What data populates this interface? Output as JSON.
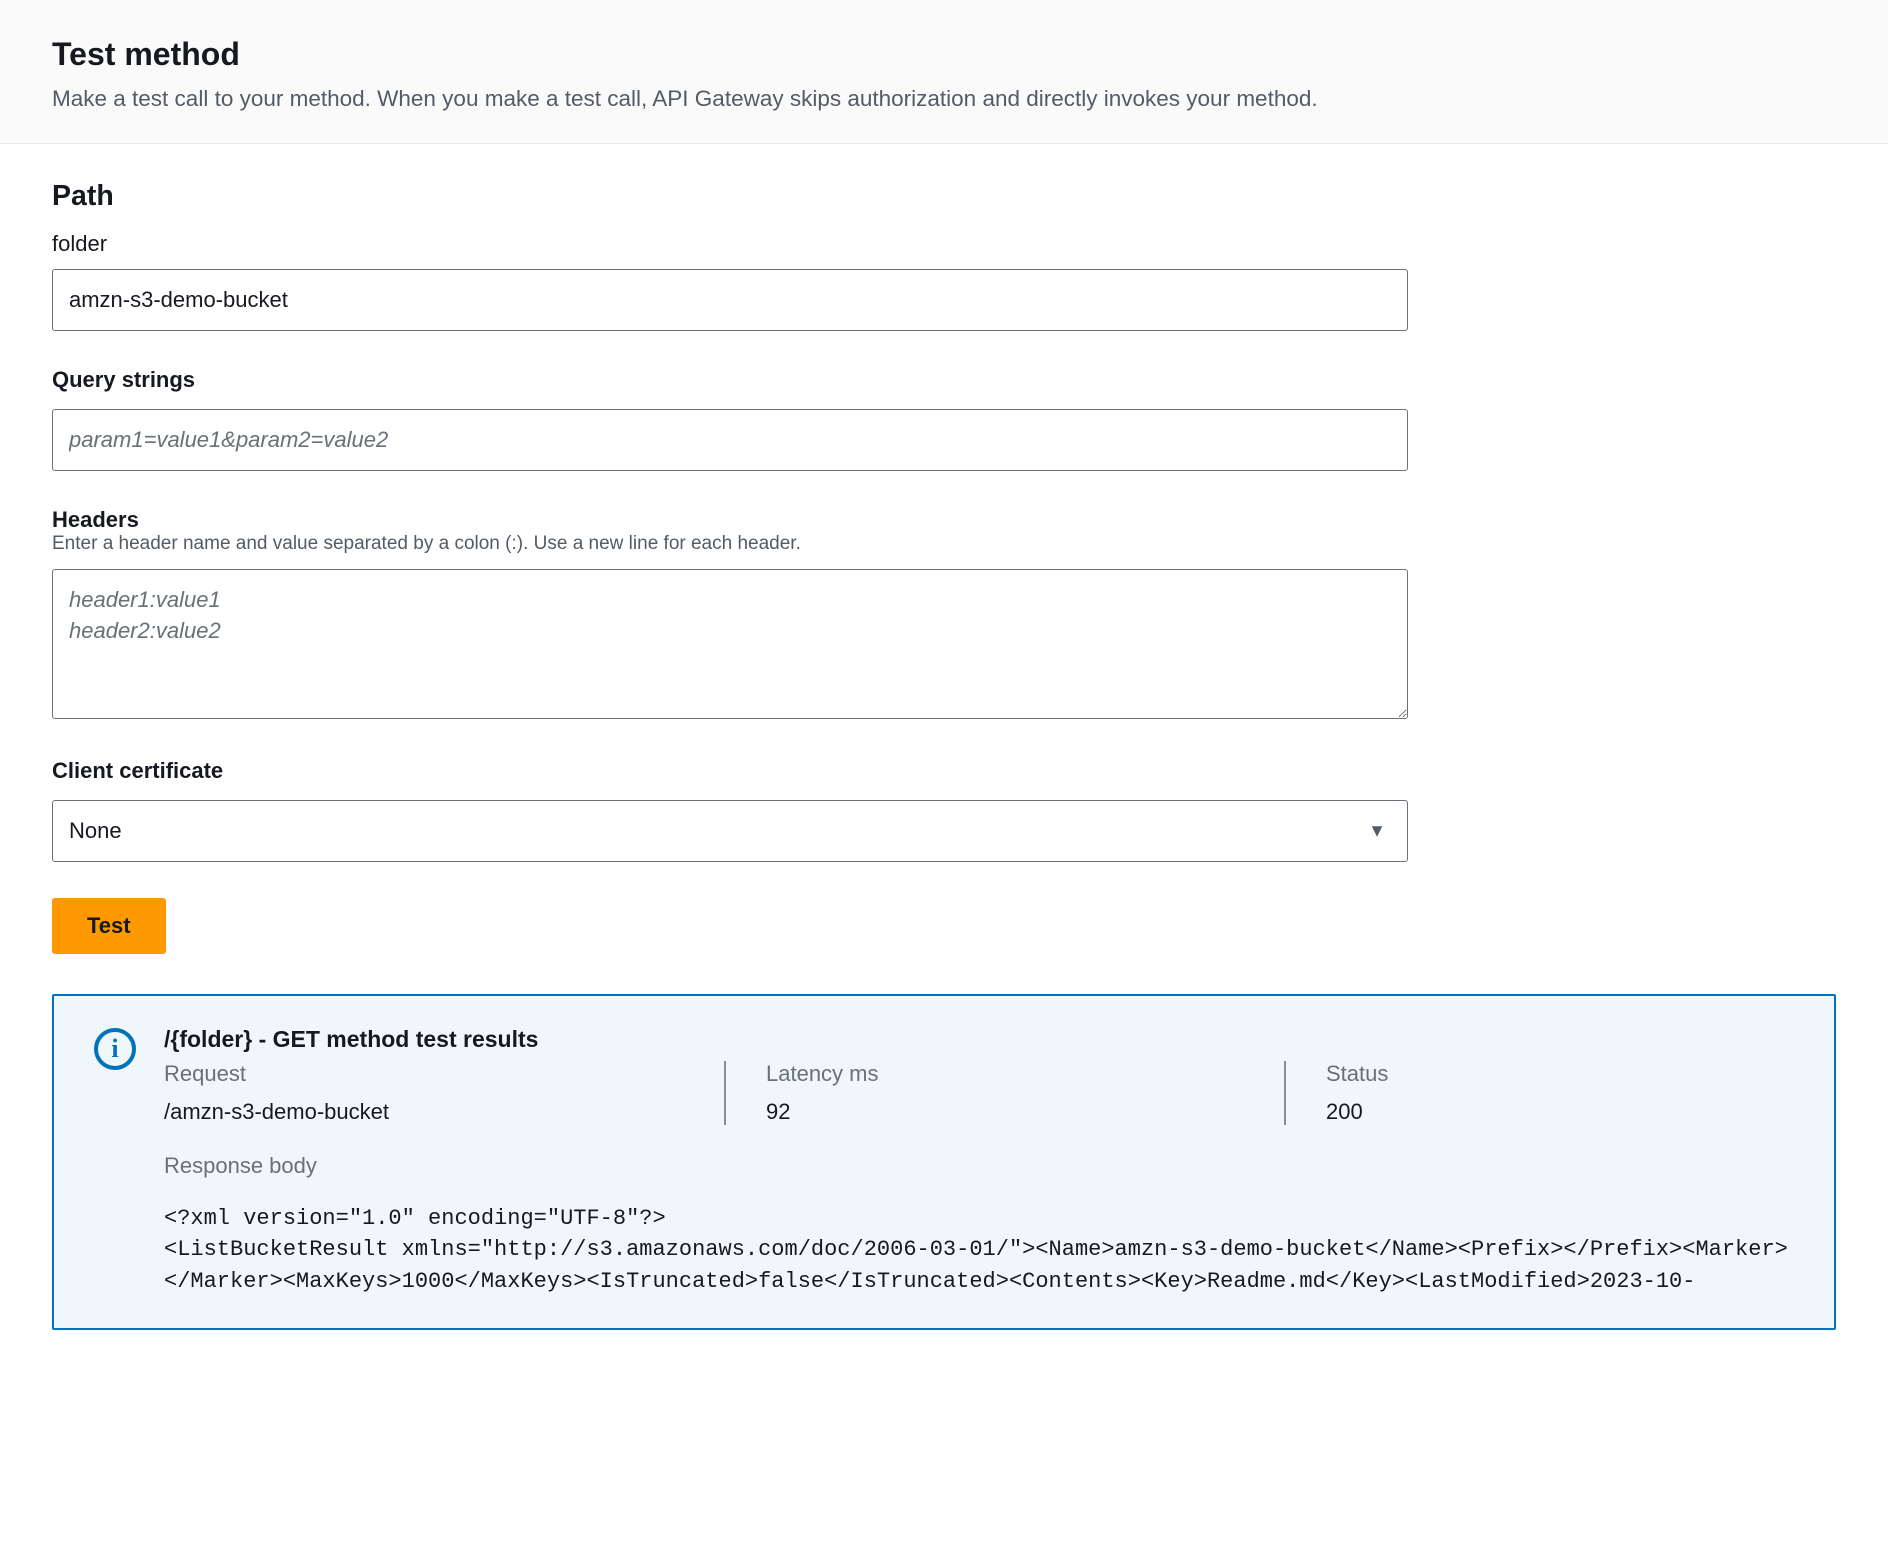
{
  "header": {
    "title": "Test method",
    "description": "Make a test call to your method. When you make a test call, API Gateway skips authorization and directly invokes your method."
  },
  "path": {
    "heading": "Path",
    "folder_label": "folder",
    "folder_value": "amzn-s3-demo-bucket"
  },
  "query": {
    "heading": "Query strings",
    "value": "",
    "placeholder": "param1=value1&param2=value2"
  },
  "headers": {
    "heading": "Headers",
    "help": "Enter a header name and value separated by a colon (:). Use a new line for each header.",
    "value": "",
    "placeholder": "header1:value1\nheader2:value2"
  },
  "certificate": {
    "heading": "Client certificate",
    "selected": "None"
  },
  "test_button": {
    "label": "Test"
  },
  "results": {
    "title": "/{folder} - GET method test results",
    "request_label": "Request",
    "request_value": "/amzn-s3-demo-bucket",
    "latency_label": "Latency ms",
    "latency_value": "92",
    "status_label": "Status",
    "status_value": "200",
    "response_body_label": "Response body",
    "response_body_value": "<?xml version=\"1.0\" encoding=\"UTF-8\"?>\n<ListBucketResult xmlns=\"http://s3.amazonaws.com/doc/2006-03-01/\"><Name>amzn-s3-demo-bucket</Name><Prefix></Prefix><Marker></Marker><MaxKeys>1000</MaxKeys><IsTruncated>false</IsTruncated><Contents><Key>Readme.md</Key><LastModified>2023-10-"
  }
}
